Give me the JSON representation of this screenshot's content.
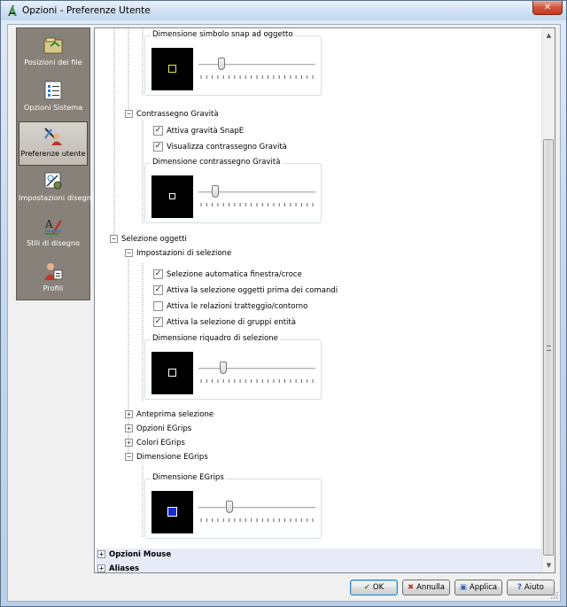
{
  "window": {
    "title": "Opzioni - Preferenze Utente",
    "close_label": "✕"
  },
  "sidebar": {
    "items": [
      {
        "label": "Posizioni dei file",
        "icon": "folder-icon"
      },
      {
        "label": "Opzioni Sistema",
        "icon": "system-options-icon"
      },
      {
        "label": "Preferenze utente",
        "icon": "user-preferences-icon",
        "selected": true
      },
      {
        "label": "Impostazioni disegno",
        "icon": "drawing-settings-icon"
      },
      {
        "label": "Stili di disegno",
        "icon": "drawing-styles-icon"
      },
      {
        "label": "Profili",
        "icon": "profiles-icon"
      }
    ]
  },
  "tree": {
    "snap_group_title": "Dimensione simbolo snap ad oggetto",
    "snap_slider": 0.2,
    "gravity": {
      "label": "Contrassegno Gravità",
      "check1": "Attiva gravità SnapE",
      "check2": "Visualizza contrassegno Gravità",
      "group_title": "Dimensione contrassegno Gravità",
      "slider": 0.15
    },
    "selection": {
      "label": "Selezione oggetti",
      "settings_label": "Impostazioni di selezione",
      "checks": [
        {
          "label": "Selezione automatica finestra/croce",
          "checked": true
        },
        {
          "label": "Attiva la selezione oggetti prima dei comandi",
          "checked": true
        },
        {
          "label": "Attiva le relazioni tratteggio/contorno",
          "checked": false
        },
        {
          "label": "Attiva la selezione di gruppi entità",
          "checked": true
        }
      ],
      "group_title": "Dimensione riquadro di selezione",
      "slider": 0.22
    },
    "preview_label": "Anteprima selezione",
    "egrips_options_label": "Opzioni EGrips",
    "egrips_colors_label": "Colori EGrips",
    "egrips_size_label": "Dimensione EGrips",
    "egrips_group_title": "Dimensione EGrips",
    "egrips_slider": 0.27,
    "mouse_label": "Opzioni Mouse",
    "aliases_label": "Aliases"
  },
  "colors": {
    "snap_marker": "#e8e84a",
    "egrips_marker": "#1a2bd6",
    "selection_bar": "#e7eaf7"
  },
  "buttons": {
    "ok": "OK",
    "cancel": "Annulla",
    "apply": "Applica",
    "help": "Aiuto"
  }
}
